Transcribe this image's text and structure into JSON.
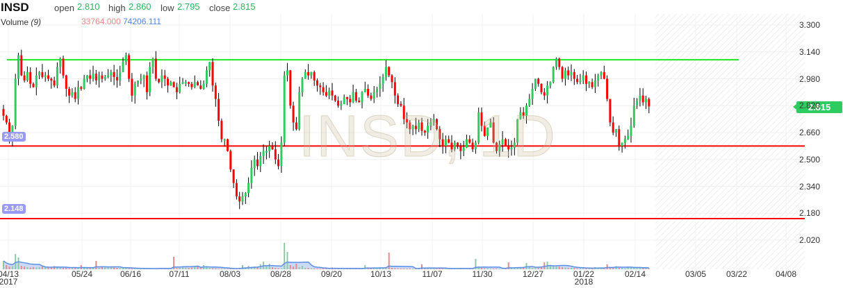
{
  "header": {
    "symbol": "INSD",
    "open_label": "open",
    "open": "2.810",
    "high_label": "high",
    "high": "2.860",
    "low_label": "low",
    "low": "2.795",
    "close_label": "close",
    "close": "2.815",
    "volume_label": "Volume",
    "volume_period": "(9)",
    "volume_value": "33764.000",
    "volume_ma": "74206.111"
  },
  "watermark": "INSD, 1D",
  "current_price": "2.815",
  "levels": [
    {
      "price": 3.093,
      "color": "#22e622",
      "label": ""
    },
    {
      "price": 2.58,
      "color": "#ff0000",
      "label": "2.580"
    },
    {
      "price": 2.148,
      "color": "#ff0000",
      "label": "2.148"
    }
  ],
  "colors": {
    "up": "#2ecc60",
    "down": "#ff0000",
    "volume_ma": "#5b8fe8",
    "volume_area": "#b8cdf5"
  },
  "chart_data": {
    "type": "candlestick",
    "title": "INSD, 1D",
    "ylim": [
      1.855,
      3.366
    ],
    "y_ticks": [
      "3.300",
      "3.140",
      "2.980",
      "2.820",
      "2.660",
      "2.500",
      "2.340",
      "2.180",
      "2.020"
    ],
    "x_ticks": [
      {
        "label": "04/13",
        "sub": "2017"
      },
      {
        "label": "05/24",
        "sub": ""
      },
      {
        "label": "06/16",
        "sub": ""
      },
      {
        "label": "07/11",
        "sub": ""
      },
      {
        "label": "08/03",
        "sub": ""
      },
      {
        "label": "08/28",
        "sub": ""
      },
      {
        "label": "09/20",
        "sub": ""
      },
      {
        "label": "10/13",
        "sub": ""
      },
      {
        "label": "11/07",
        "sub": ""
      },
      {
        "label": "11/30",
        "sub": ""
      },
      {
        "label": "12/27",
        "sub": ""
      },
      {
        "label": "01/22",
        "sub": "2018"
      },
      {
        "label": "02/14",
        "sub": ""
      },
      {
        "label": "03/05",
        "sub": ""
      },
      {
        "label": "03/22",
        "sub": ""
      },
      {
        "label": "04/08",
        "sub": ""
      }
    ],
    "closes": [
      2.76,
      2.72,
      2.62,
      2.7,
      2.98,
      3.12,
      3.0,
      2.97,
      3.02,
      2.95,
      2.93,
      3.0,
      3.02,
      2.99,
      3.0,
      2.98,
      2.97,
      2.94,
      3.05,
      3.1,
      3.0,
      2.92,
      2.88,
      2.9,
      2.86,
      2.93,
      2.92,
      2.98,
      3.0,
      2.98,
      3.01,
      2.97,
      3.0,
      2.98,
      2.99,
      3.0,
      3.02,
      2.99,
      2.97,
      3.02,
      3.08,
      3.12,
      2.98,
      2.88,
      2.95,
      2.97,
      2.98,
      3.0,
      2.9,
      3.05,
      3.1,
      2.98,
      2.96,
      3.0,
      2.98,
      2.94,
      2.96,
      2.93,
      2.9,
      2.95,
      2.96,
      2.96,
      2.95,
      2.93,
      2.96,
      2.94,
      2.92,
      2.95,
      3.03,
      3.08,
      2.94,
      2.86,
      2.73,
      2.62,
      2.62,
      2.55,
      2.44,
      2.36,
      2.28,
      2.25,
      2.28,
      2.3,
      2.36,
      2.45,
      2.5,
      2.46,
      2.52,
      2.55,
      2.55,
      2.58,
      2.56,
      2.5,
      2.46,
      2.6,
      3.0,
      3.03,
      2.82,
      2.72,
      2.68,
      2.9,
      2.98,
      3.02,
      3.0,
      3.02,
      2.97,
      2.94,
      2.93,
      2.9,
      2.88,
      2.91,
      2.88,
      2.85,
      2.82,
      2.83,
      2.87,
      2.86,
      2.84,
      2.9,
      2.85,
      2.84,
      2.9,
      2.92,
      2.88,
      2.86,
      2.9,
      2.92,
      2.95,
      2.99,
      3.05,
      3.0,
      2.96,
      2.88,
      2.83,
      2.82,
      2.74,
      2.72,
      2.68,
      2.7,
      2.68,
      2.72,
      2.67,
      2.66,
      2.7,
      2.72,
      2.74,
      2.68,
      2.62,
      2.58,
      2.62,
      2.6,
      2.56,
      2.6,
      2.58,
      2.55,
      2.57,
      2.62,
      2.6,
      2.56,
      2.6,
      2.78,
      2.7,
      2.64,
      2.69,
      2.72,
      2.6,
      2.55,
      2.59,
      2.62,
      2.58,
      2.56,
      2.57,
      2.6,
      2.74,
      2.78,
      2.76,
      2.82,
      2.86,
      2.92,
      2.98,
      2.95,
      2.9,
      2.88,
      2.94,
      2.96,
      3.05,
      3.1,
      3.05,
      2.98,
      3.03,
      3.0,
      3.02,
      2.98,
      2.96,
      2.97,
      3.0,
      2.95,
      2.96,
      2.93,
      2.97,
      3.0,
      3.02,
      2.98,
      2.86,
      2.72,
      2.66,
      2.68,
      2.58,
      2.6,
      2.62,
      2.64,
      2.7,
      2.82,
      2.85,
      2.88,
      2.84,
      2.86,
      2.815
    ],
    "volumes_k": [
      120,
      60,
      40,
      45,
      220,
      170,
      50,
      40,
      30,
      25,
      30,
      25,
      35,
      40,
      30,
      25,
      30,
      45,
      30,
      25,
      20,
      20,
      15,
      15,
      20,
      20,
      60,
      25,
      20,
      15,
      15,
      120,
      20,
      30,
      25,
      35,
      30,
      25,
      20,
      15,
      15,
      15,
      10,
      10,
      10,
      10,
      12,
      10,
      10,
      12,
      10,
      10,
      15,
      20,
      15,
      10,
      12,
      180,
      15,
      20,
      40,
      25,
      20,
      25,
      35,
      50,
      30,
      60,
      40,
      20,
      15,
      12,
      10,
      10,
      10,
      8,
      10,
      8,
      10,
      20,
      60,
      30,
      50,
      35,
      40,
      30,
      70,
      110,
      40,
      80,
      30,
      20,
      15,
      10,
      380,
      250,
      60,
      40,
      80,
      30,
      50,
      20,
      20,
      15,
      10,
      10,
      10,
      12,
      10,
      15,
      25,
      15,
      10,
      10,
      10,
      10,
      10,
      10,
      12,
      10,
      15,
      60,
      15,
      20,
      15,
      15,
      20,
      25,
      15,
      240,
      20,
      15,
      12,
      10,
      10,
      10,
      12,
      10,
      15,
      10,
      70,
      15,
      12,
      10,
      10,
      10,
      15,
      10,
      10,
      12,
      10,
      10,
      10,
      20,
      10,
      12,
      10,
      12,
      150,
      40,
      20,
      15,
      15,
      10,
      10,
      12,
      10,
      10,
      10,
      100,
      15,
      20,
      30,
      20,
      25,
      90,
      30,
      20,
      20,
      20,
      40,
      100,
      110,
      60,
      50,
      40,
      40,
      30,
      25,
      20,
      20,
      20,
      15,
      15,
      20,
      15,
      15,
      10,
      30,
      20,
      25,
      20,
      70,
      30,
      20,
      45,
      20,
      20,
      15,
      40,
      25,
      20,
      30,
      20,
      15,
      15,
      15
    ]
  }
}
